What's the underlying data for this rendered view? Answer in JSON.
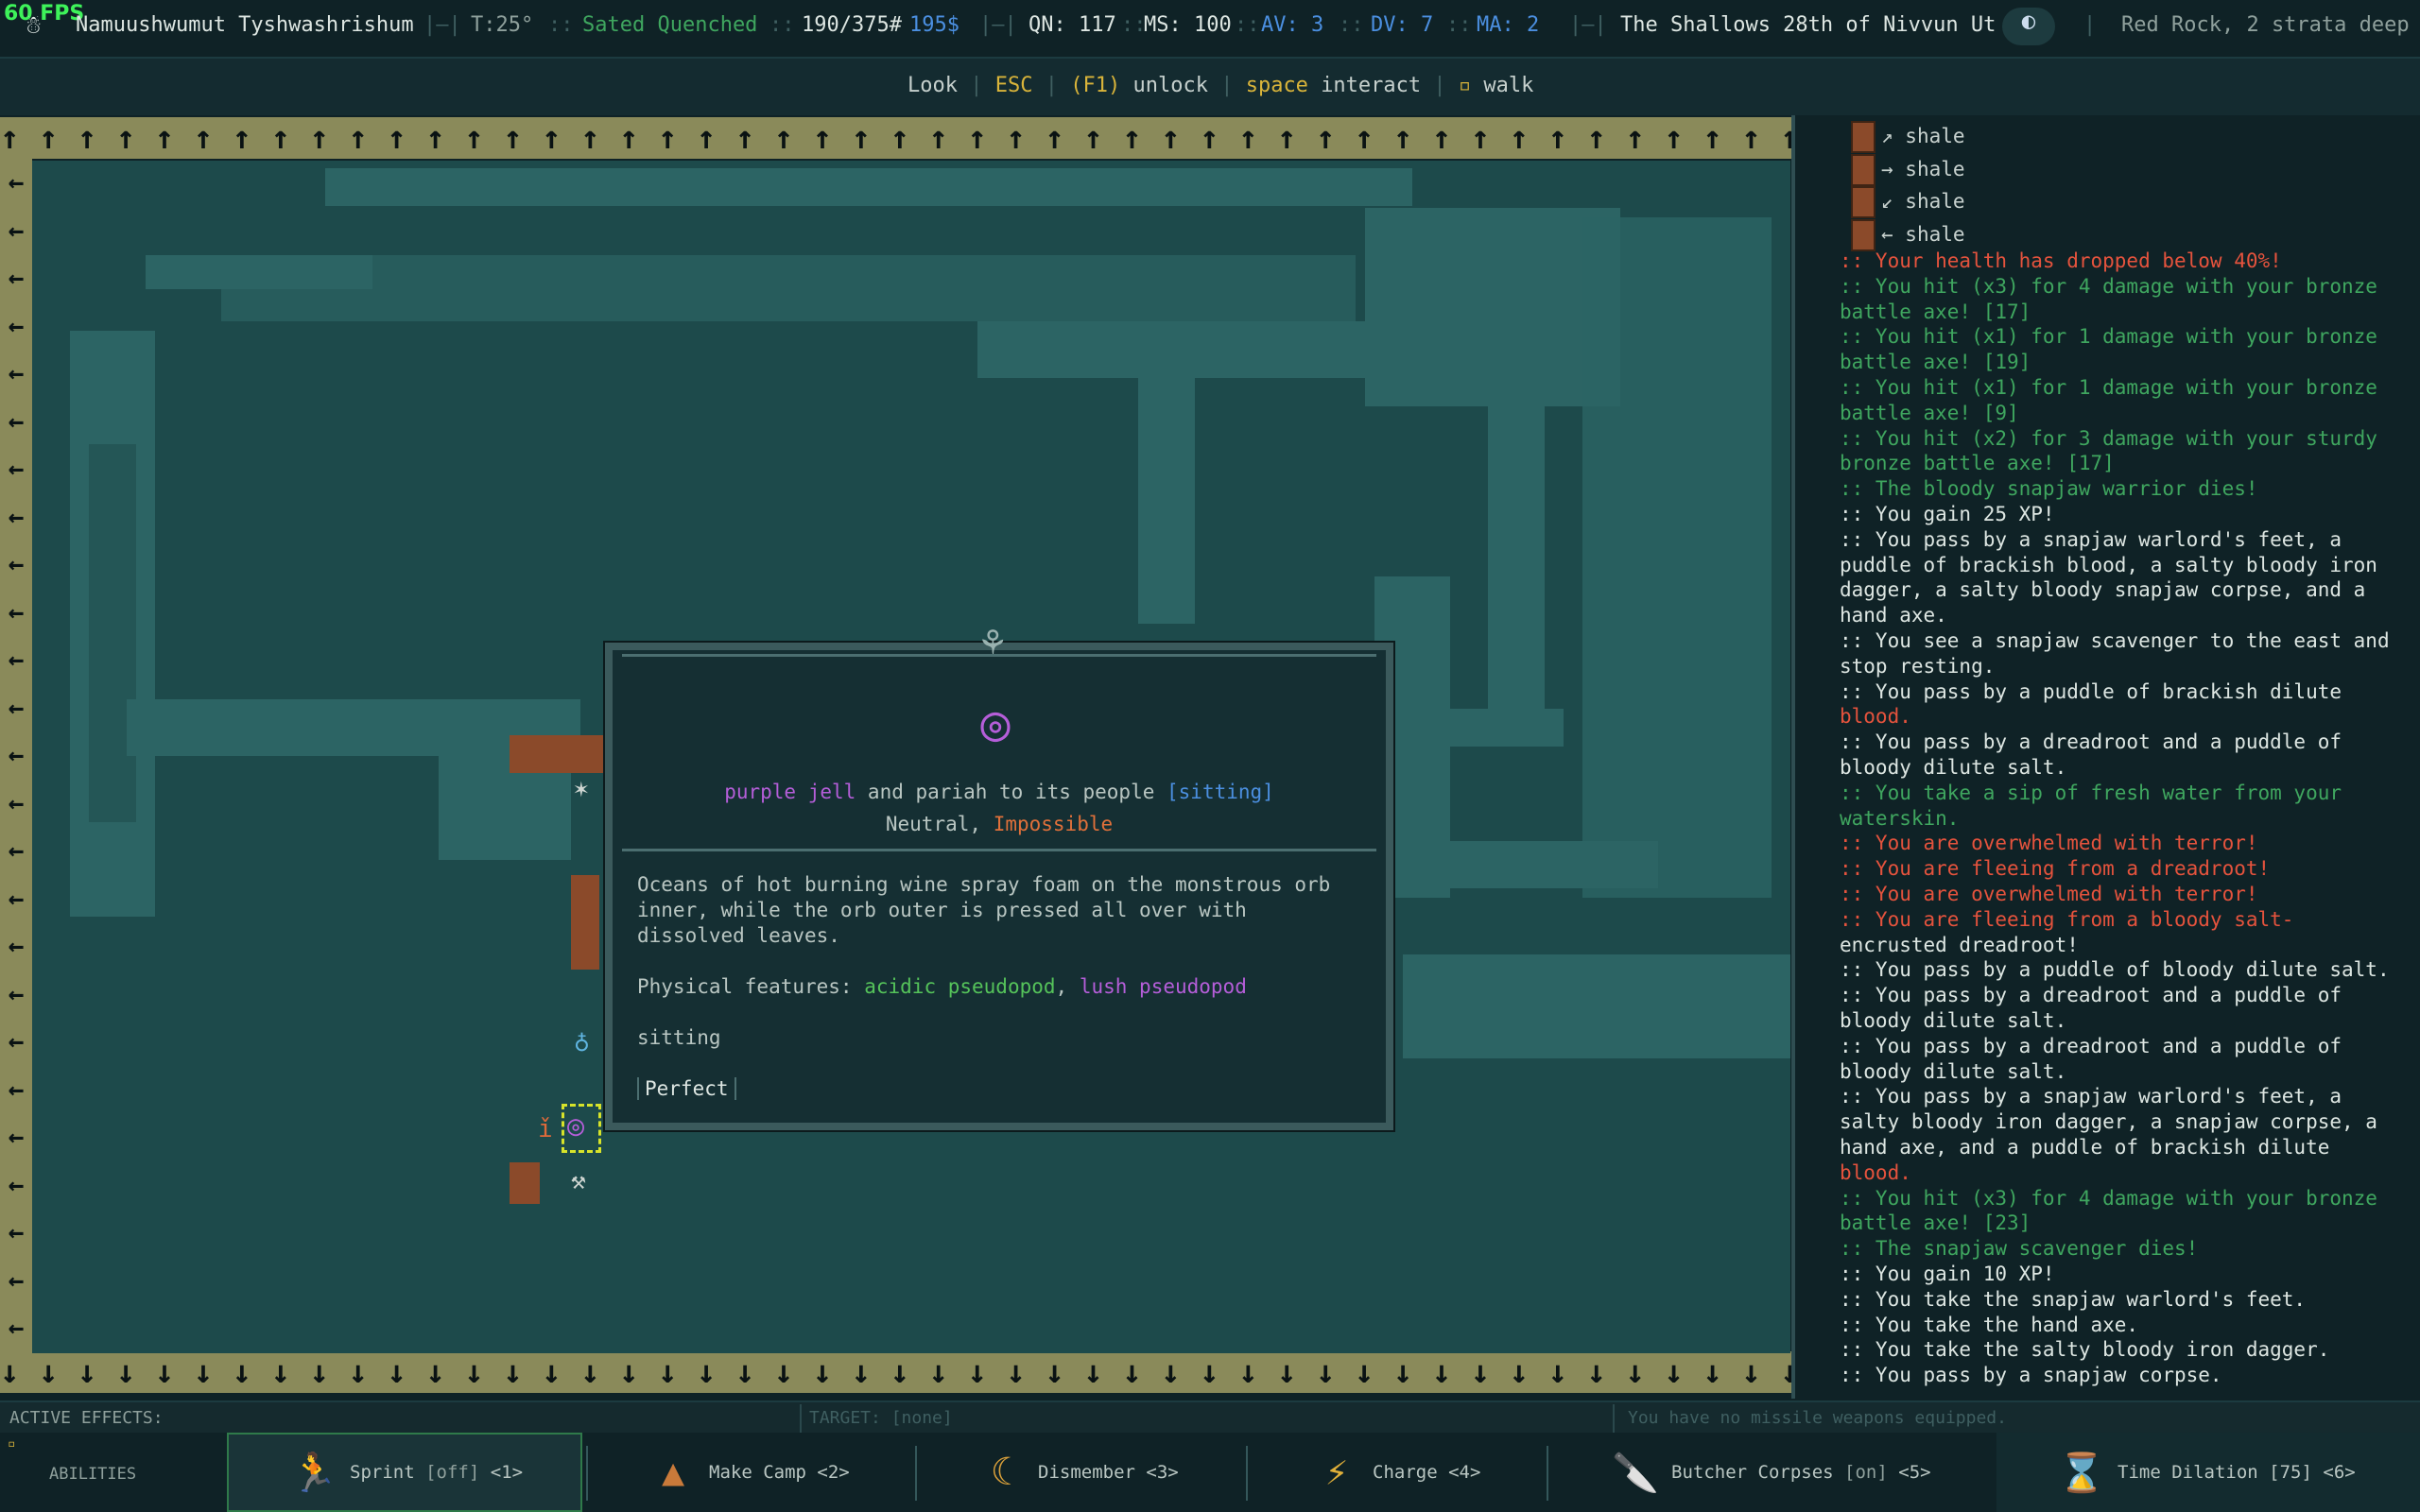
{
  "topbar": {
    "fps": "60 FPS",
    "player_name": "Namuushwumut Tyshwashrishum",
    "temperature": "T:25°",
    "hunger_status": "Sated Quenched",
    "weight": "190/375#",
    "drams": "195$",
    "qn": "QN: 117",
    "ms": "MS: 100",
    "av": "AV: 3",
    "dv": "DV: 7",
    "ma": "MA: 2",
    "date": "The Shallows 28th of Nivvun Ut",
    "location": "Red Rock, 2 strata deep"
  },
  "hintbar": {
    "look": "Look",
    "esc": "ESC",
    "f1": "(F1)",
    "unlock": "unlock",
    "space": "space",
    "interact": "interact",
    "walk": "walk"
  },
  "popup": {
    "name_part1": "purple jell",
    "name_part2": "and pariah to its people",
    "name_status": "[sitting]",
    "disposition1": "Neutral,",
    "disposition2": "Impossible",
    "desc1": "Oceans of hot burning wine spray foam on the monstrous orb",
    "desc2": "inner, while the orb outer is pressed all over with",
    "desc3": "dissolved leaves.",
    "features_label": "Physical features:",
    "feature1": "acidic pseudopod",
    "feature_sep": ",",
    "feature2": "lush pseudopod",
    "posture": "sitting",
    "health": "Perfect"
  },
  "log": {
    "shale": [
      "shale",
      "shale",
      "shale",
      "shale"
    ],
    "lines": [
      {
        "text": ":: Your health has dropped below 40%!",
        "color": "#e5533d"
      },
      {
        "text": ":: You hit (x3) for 4 damage with your bronze",
        "color": "#3fa65f"
      },
      {
        "text": "battle axe! [17]",
        "color": "#3fa65f"
      },
      {
        "text": ":: You hit (x1) for 1 damage with your bronze",
        "color": "#3fa65f"
      },
      {
        "text": "battle axe! [19]",
        "color": "#3fa65f"
      },
      {
        "text": ":: You hit (x1) for 1 damage with your bronze",
        "color": "#3fa65f"
      },
      {
        "text": "battle axe! [9]",
        "color": "#3fa65f"
      },
      {
        "text": ":: You hit (x2) for 3 damage with your sturdy",
        "color": "#3fa65f"
      },
      {
        "text": "bronze battle axe! [17]",
        "color": "#3fa65f"
      },
      {
        "text": ":: The bloody snapjaw warrior dies!",
        "color": "#3fa65f"
      },
      {
        "text": ":: You gain 25 XP!",
        "color": "#dde6e2"
      },
      {
        "text": ":: You pass by a snapjaw warlord's feet, a",
        "color": "#dde6e2"
      },
      {
        "text": "puddle of brackish blood, a salty bloody iron",
        "color": "#dde6e2"
      },
      {
        "text": "dagger, a salty bloody snapjaw corpse, and a",
        "color": "#dde6e2"
      },
      {
        "text": "hand axe.",
        "color": "#dde6e2"
      },
      {
        "text": ":: You see a snapjaw scavenger to the east and",
        "color": "#dde6e2"
      },
      {
        "text": "stop resting.",
        "color": "#dde6e2"
      },
      {
        "text": ":: You pass by a puddle of brackish dilute",
        "color": "#dde6e2"
      },
      {
        "text": "blood.",
        "color": "#e5533d"
      },
      {
        "text": ":: You pass by a dreadroot and a puddle of",
        "color": "#dde6e2"
      },
      {
        "text": "bloody dilute salt.",
        "color": "#dde6e2"
      },
      {
        "text": ":: You take a sip of fresh water from your",
        "color": "#3fa65f"
      },
      {
        "text": "waterskin.",
        "color": "#3fa65f"
      },
      {
        "text": ":: You are overwhelmed with terror!",
        "color": "#e5533d"
      },
      {
        "text": ":: You are fleeing from a dreadroot!",
        "color": "#e5533d"
      },
      {
        "text": ":: You are overwhelmed with terror!",
        "color": "#e5533d"
      },
      {
        "text": ":: You are fleeing from a bloody salt-",
        "color": "#e5533d"
      },
      {
        "text": "encrusted dreadroot!",
        "color": "#dde6e2"
      },
      {
        "text": ":: You pass by a puddle of bloody dilute salt.",
        "color": "#dde6e2"
      },
      {
        "text": ":: You pass by a dreadroot and a puddle of",
        "color": "#dde6e2"
      },
      {
        "text": "bloody dilute salt.",
        "color": "#dde6e2"
      },
      {
        "text": ":: You pass by a dreadroot and a puddle of",
        "color": "#dde6e2"
      },
      {
        "text": "bloody dilute salt.",
        "color": "#dde6e2"
      },
      {
        "text": ":: You pass by a snapjaw warlord's feet, a",
        "color": "#dde6e2"
      },
      {
        "text": "salty bloody iron dagger, a snapjaw corpse, a",
        "color": "#dde6e2"
      },
      {
        "text": "hand axe, and a puddle of brackish dilute",
        "color": "#dde6e2"
      },
      {
        "text": "blood.",
        "color": "#e5533d"
      },
      {
        "text": ":: You hit (x3) for 4 damage with your bronze",
        "color": "#3fa65f"
      },
      {
        "text": "battle axe! [23]",
        "color": "#3fa65f"
      },
      {
        "text": ":: The snapjaw scavenger dies!",
        "color": "#3fa65f"
      },
      {
        "text": ":: You gain 10 XP!",
        "color": "#dde6e2"
      },
      {
        "text": ":: You take the snapjaw warlord's feet.",
        "color": "#dde6e2"
      },
      {
        "text": ":: You take the hand axe.",
        "color": "#dde6e2"
      },
      {
        "text": ":: You take the salty bloody iron dagger.",
        "color": "#dde6e2"
      },
      {
        "text": ":: You pass by a snapjaw corpse.",
        "color": "#dde6e2"
      }
    ]
  },
  "effects": {
    "active": "ACTIVE EFFECTS:",
    "target": "TARGET: [none]",
    "missile": "You have no missile weapons equipped."
  },
  "abilities": {
    "label": "ABILITIES",
    "items": [
      {
        "name": "Sprint",
        "state": "[off]",
        "key": "<1>"
      },
      {
        "name": "Make Camp",
        "state": "",
        "key": "<2>"
      },
      {
        "name": "Dismember",
        "state": "",
        "key": "<3>"
      },
      {
        "name": "Charge",
        "state": "",
        "key": "<4>"
      },
      {
        "name": "Butcher Corpses",
        "state": "[on]",
        "key": "<5>"
      },
      {
        "name": "Time Dilation",
        "state": "[75]",
        "key": "<6>"
      }
    ]
  },
  "colors": {
    "red": "#e5533d",
    "green": "#3fa65f",
    "purple": "#b55ed9",
    "blue": "#4b8fe0",
    "gold": "#d9b43a"
  }
}
